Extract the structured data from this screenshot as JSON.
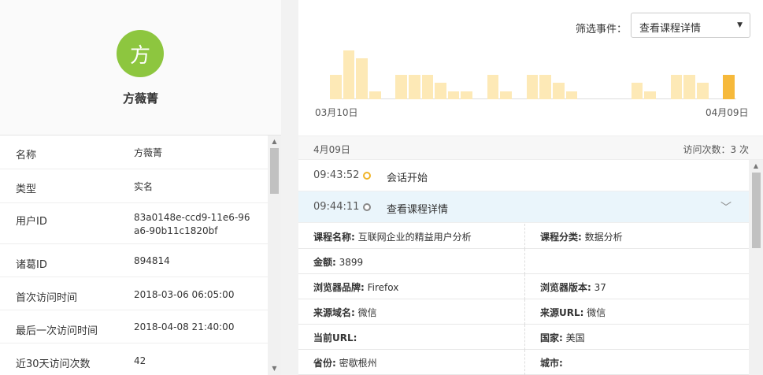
{
  "profile": {
    "avatar_char": "方",
    "name": "方薇菁"
  },
  "info": [
    {
      "key": "名称",
      "value": "方薇菁"
    },
    {
      "key": "类型",
      "value": "实名"
    },
    {
      "key": "用户ID",
      "value": "83a0148e-ccd9-11e6-96a6-90b11c1820bf"
    },
    {
      "key": "诸葛ID",
      "value": "894814"
    },
    {
      "key": "首次访问时间",
      "value": "2018-03-06 06:05:00"
    },
    {
      "key": "最后一次访问时间",
      "value": "2018-04-08 21:40:00"
    },
    {
      "key": "近30天访问次数",
      "value": "42"
    }
  ],
  "filter": {
    "label": "筛选事件：",
    "selected": "查看课程详情"
  },
  "chart_data": {
    "type": "bar",
    "x_start_label": "03月10日",
    "x_end_label": "04月09日",
    "values": [
      3,
      6,
      5,
      1,
      0,
      3,
      3,
      3,
      2,
      1,
      1,
      0,
      3,
      1,
      0,
      3,
      3,
      2,
      1,
      0,
      0,
      0,
      0,
      2,
      1,
      0,
      3,
      3,
      2,
      0,
      3
    ],
    "highlight_index": 30,
    "colors": {
      "bar": "#fde9b6",
      "active": "#f6b93b"
    }
  },
  "day": {
    "date": "4月09日",
    "count_text": "访问次数：3 次"
  },
  "events": [
    {
      "time": "09:43:52",
      "name": "会话开始"
    },
    {
      "time": "09:44:11",
      "name": "查看课程详情"
    }
  ],
  "details": [
    {
      "l_key": "课程名称:",
      "l_val": " 互联网企业的精益用户分析",
      "r_key": "课程分类:",
      "r_val": " 数据分析"
    },
    {
      "l_key": "金额:",
      "l_val": " 3899",
      "r_key": "",
      "r_val": ""
    },
    {
      "l_key": "浏览器品牌:",
      "l_val": " Firefox",
      "r_key": "浏览器版本:",
      "r_val": " 37"
    },
    {
      "l_key": "来源域名:",
      "l_val": " 微信",
      "r_key": "来源URL:",
      "r_val": " 微信"
    },
    {
      "l_key": "当前URL:",
      "l_val": "",
      "r_key": "国家:",
      "r_val": " 美国"
    },
    {
      "l_key": "省份:",
      "l_val": " 密歇根州",
      "r_key": "城市:",
      "r_val": ""
    }
  ]
}
